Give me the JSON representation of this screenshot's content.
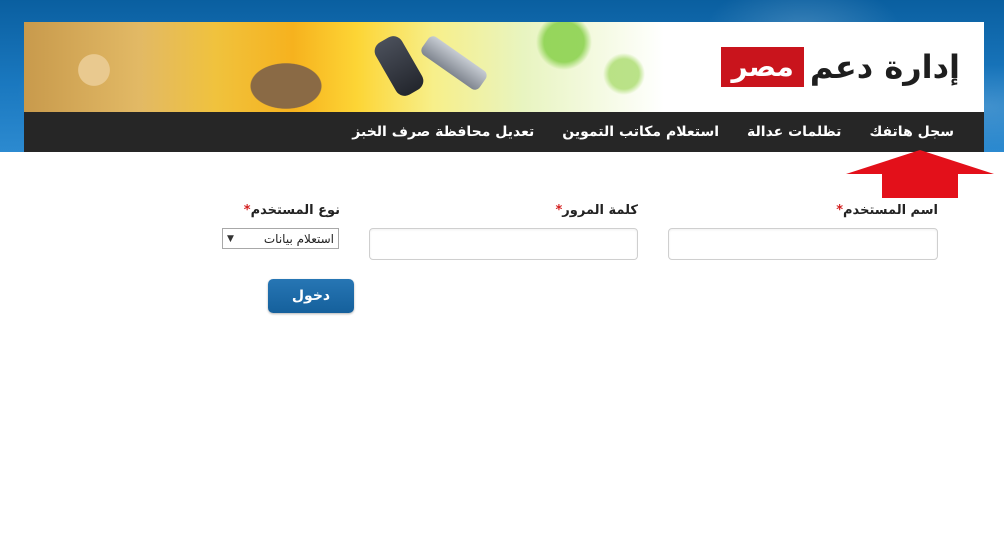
{
  "header": {
    "logo_text": "إدارة دعم",
    "logo_badge": "مصر"
  },
  "nav": {
    "items": [
      {
        "label": "سجل هاتفك"
      },
      {
        "label": "تظلمات عدالة"
      },
      {
        "label": "استعلام مكاتب التموين"
      },
      {
        "label": "تعديل محافظة صرف الخبز"
      }
    ]
  },
  "form": {
    "username_label": "اسم المستخدم",
    "username_value": "",
    "password_label": "كلمة المرور",
    "password_value": "",
    "usertype_label": "نوع المستخدم",
    "usertype_selected": "استعلام بيانات",
    "required_mark": "*",
    "submit_label": "دخول"
  },
  "colors": {
    "header_blue": "#1a78bf",
    "nav_bg": "#262626",
    "logo_red": "#c9141c",
    "button_blue": "#1f6aa8",
    "arrow_red": "#e3101a",
    "required_red": "#d42020"
  },
  "icons": {
    "arrow": "up-arrow-icon",
    "select_caret": "caret-down-icon"
  }
}
